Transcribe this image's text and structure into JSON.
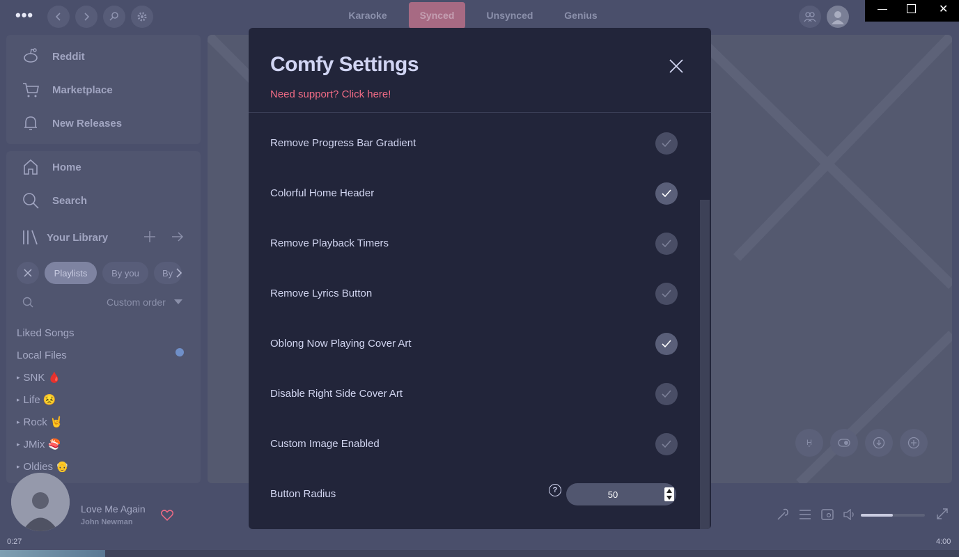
{
  "topbar": {
    "menu_label": "•••",
    "lyrics_tabs": [
      {
        "label": "Karaoke",
        "active": false
      },
      {
        "label": "Synced",
        "active": true
      },
      {
        "label": "Unsynced",
        "active": false
      },
      {
        "label": "Genius",
        "active": false
      }
    ]
  },
  "sidebar": {
    "top_items": [
      {
        "label": "Reddit",
        "icon": "reddit-icon"
      },
      {
        "label": "Marketplace",
        "icon": "cart-icon"
      },
      {
        "label": "New Releases",
        "icon": "bell-icon"
      }
    ],
    "nav_items": [
      {
        "label": "Home",
        "icon": "home-icon"
      },
      {
        "label": "Search",
        "icon": "search-icon"
      }
    ],
    "library": {
      "title": "Your Library",
      "chips": [
        "Playlists",
        "By you",
        "By"
      ],
      "sort_label": "Custom order",
      "items": [
        "Liked Songs",
        "Local Files",
        "SNK 🩸",
        "Life 😣",
        "Rock 🤘",
        "JMix 🍣",
        "Oldies 👴"
      ]
    }
  },
  "now_playing": {
    "title": "Love Me Again",
    "artist": "John Newman",
    "elapsed": "0:27",
    "duration": "4:00",
    "progress": 0.11,
    "volume": 0.5
  },
  "modal": {
    "title": "Comfy Settings",
    "support_link": "Need support? Click here!",
    "settings": [
      {
        "label": "Remove Progress Bar Gradient",
        "enabled": false
      },
      {
        "label": "Colorful Home Header",
        "enabled": true
      },
      {
        "label": "Remove Playback Timers",
        "enabled": false
      },
      {
        "label": "Remove Lyrics Button",
        "enabled": false
      },
      {
        "label": "Oblong Now Playing Cover Art",
        "enabled": true
      },
      {
        "label": "Disable Right Side Cover Art",
        "enabled": false
      },
      {
        "label": "Custom Image Enabled",
        "enabled": false
      }
    ],
    "button_radius": {
      "label": "Button Radius",
      "value": "50",
      "help": "?"
    }
  },
  "colors": {
    "accent": "#f06b85",
    "modal_bg": "#22253a",
    "app_bg": "#4a4f6b"
  }
}
